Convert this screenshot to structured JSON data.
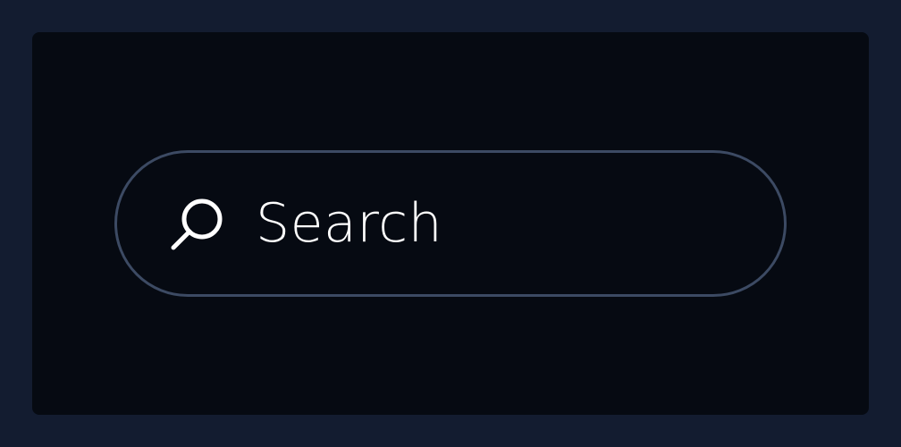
{
  "search": {
    "placeholder": "Search",
    "icon": "search-icon"
  },
  "colors": {
    "page_background": "#131c30",
    "panel_background": "#060a12",
    "border": "#3c4a63",
    "text": "#ffffff"
  }
}
